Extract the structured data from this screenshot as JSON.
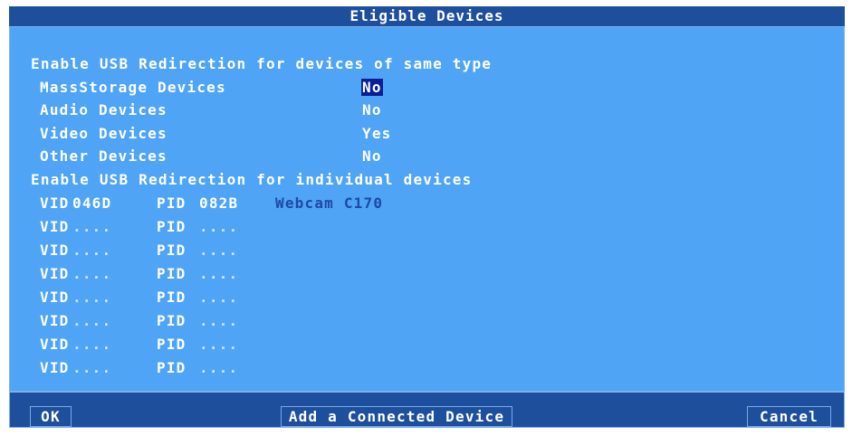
{
  "window": {
    "title": "Eligible Devices"
  },
  "type_section": {
    "header": "Enable USB Redirection for devices of same type",
    "rows": [
      {
        "label": "MassStorage Devices",
        "value": "No"
      },
      {
        "label": "Audio Devices",
        "value": "No"
      },
      {
        "label": "Video Devices",
        "value": "Yes"
      },
      {
        "label": "Other Devices",
        "value": "No"
      }
    ]
  },
  "individual_section": {
    "header": "Enable USB Redirection for individual devices",
    "vid_label": "VID",
    "pid_label": "PID",
    "rows": [
      {
        "vid": "046D",
        "pid": "082B",
        "name": "Webcam C170"
      },
      {
        "vid": "....",
        "pid": "....",
        "name": ""
      },
      {
        "vid": "....",
        "pid": "....",
        "name": ""
      },
      {
        "vid": "....",
        "pid": "....",
        "name": ""
      },
      {
        "vid": "....",
        "pid": "....",
        "name": ""
      },
      {
        "vid": "....",
        "pid": "....",
        "name": ""
      },
      {
        "vid": "....",
        "pid": "....",
        "name": ""
      },
      {
        "vid": "....",
        "pid": "....",
        "name": ""
      }
    ]
  },
  "buttons": {
    "ok": "OK",
    "add": "Add a Connected Device",
    "cancel": "Cancel"
  }
}
